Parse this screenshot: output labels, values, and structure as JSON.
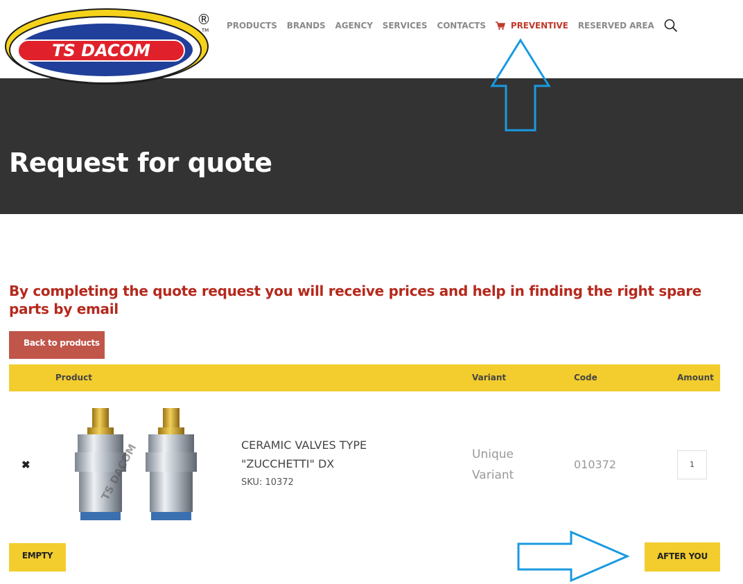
{
  "logo": {
    "text": "TS DACOM",
    "registered": "®",
    "trademark": "TM"
  },
  "nav": {
    "items": [
      "PRODUCTS",
      "BRANDS",
      "AGENCY",
      "SERVICES",
      "CONTACTS"
    ],
    "active": "PREVENTIVE",
    "reserved": "RESERVED AREA"
  },
  "hero": {
    "title": "Request for quote"
  },
  "intro": "By completing the quote request you will receive prices and help in finding the right spare parts by email",
  "back_button": "Back to products",
  "table": {
    "headers": {
      "product": "Product",
      "variant": "Variant",
      "code": "Code",
      "amount": "Amount"
    },
    "rows": [
      {
        "remove": "✖",
        "name": "CERAMIC VALVES TYPE \"ZUCCHETTI\" DX",
        "sku": "SKU: 10372",
        "variant": "Unique Variant",
        "code": "010372",
        "amount": "1",
        "watermark": "TS DACOM"
      }
    ]
  },
  "empty_button": "EMPTY",
  "after_button": "AFTER YOU",
  "colors": {
    "dark": "#333333",
    "yellow": "#f3cd2e",
    "red": "#b5291d",
    "arrow": "#1a9ae0"
  }
}
